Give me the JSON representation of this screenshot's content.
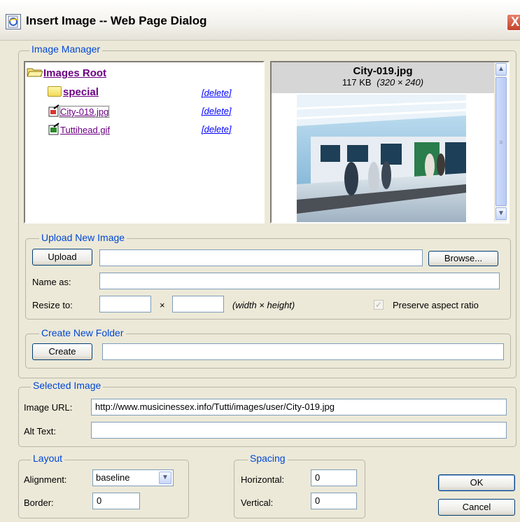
{
  "window": {
    "title": "Insert Image -- Web Page Dialog",
    "close_glyph": "X"
  },
  "image_manager": {
    "legend": "Image Manager",
    "root_label": "Images Root",
    "items": [
      {
        "icon": "folder-icon",
        "name": "special",
        "delete": "[delete]"
      },
      {
        "icon": "jpg-file-icon",
        "name": "City-019.jpg",
        "delete": "[delete]"
      },
      {
        "icon": "gif-file-icon",
        "name": "Tuttihead.gif",
        "delete": "[delete]"
      }
    ],
    "preview": {
      "filename": "City-019.jpg",
      "size": "117 KB",
      "dimensions": "(320 × 240)"
    }
  },
  "upload": {
    "legend": "Upload New Image",
    "upload_label": "Upload",
    "file_value": "",
    "browse_label": "Browse...",
    "name_as_label": "Name as:",
    "name_as_value": "",
    "resize_label": "Resize to:",
    "width_value": "",
    "times": "×",
    "height_value": "",
    "width_height_hint": "(width × height)",
    "preserve_label": "Preserve aspect ratio",
    "preserve_checked": true
  },
  "folder": {
    "legend": "Create New Folder",
    "create_label": "Create",
    "folder_value": ""
  },
  "selected": {
    "legend": "Selected Image",
    "url_label": "Image URL:",
    "url_value": "http://www.musicinessex.info/Tutti/images/user/City-019.jpg",
    "alt_label": "Alt Text:",
    "alt_value": ""
  },
  "layout": {
    "legend": "Layout",
    "alignment_label": "Alignment:",
    "alignment_value": "baseline",
    "border_label": "Border:",
    "border_value": "0"
  },
  "spacing": {
    "legend": "Spacing",
    "horizontal_label": "Horizontal:",
    "horizontal_value": "0",
    "vertical_label": "Vertical:",
    "vertical_value": "0"
  },
  "actions": {
    "ok_label": "OK",
    "cancel_label": "Cancel"
  },
  "colors": {
    "dialog_bg": "#ece9d8",
    "legend_text": "#0046d5",
    "link_visited": "#6b0082",
    "delete_link": "#0000ff"
  }
}
